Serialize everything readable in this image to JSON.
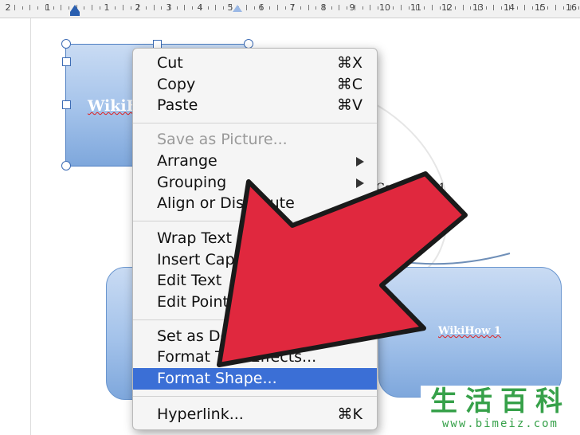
{
  "ruler": {
    "numbers": [
      "2",
      "1",
      "1",
      "2",
      "3",
      "4",
      "5",
      "6",
      "7",
      "8",
      "9",
      "10",
      "11",
      "12",
      "13",
      "14",
      "15",
      "16"
    ]
  },
  "canvas": {
    "top_shape_text": "WikiHow",
    "right_shape_text": "WikiHow 1",
    "connector_label": "Connector 1"
  },
  "context_menu": {
    "groups": [
      [
        {
          "label": "Cut",
          "shortcut": "⌘X"
        },
        {
          "label": "Copy",
          "shortcut": "⌘C"
        },
        {
          "label": "Paste",
          "shortcut": "⌘V"
        }
      ],
      [
        {
          "label": "Save as Picture...",
          "disabled": true
        },
        {
          "label": "Arrange",
          "submenu": true
        },
        {
          "label": "Grouping",
          "submenu": true
        },
        {
          "label": "Align or Distribute",
          "submenu": true
        }
      ],
      [
        {
          "label": "Wrap Text"
        },
        {
          "label": "Insert Caption..."
        },
        {
          "label": "Edit Text"
        },
        {
          "label": "Edit Points"
        }
      ],
      [
        {
          "label": "Set as Default Shape"
        },
        {
          "label": "Format Text Effects..."
        },
        {
          "label": "Format Shape...",
          "selected": true
        }
      ],
      [
        {
          "label": "Hyperlink...",
          "shortcut": "⌘K"
        }
      ]
    ]
  },
  "overlay": {
    "arrow_color": "#e0283e",
    "arrow_outline": "#1a1a1a"
  },
  "watermark": {
    "chinese": "生活百科",
    "url": "www.bimeiz.com"
  }
}
